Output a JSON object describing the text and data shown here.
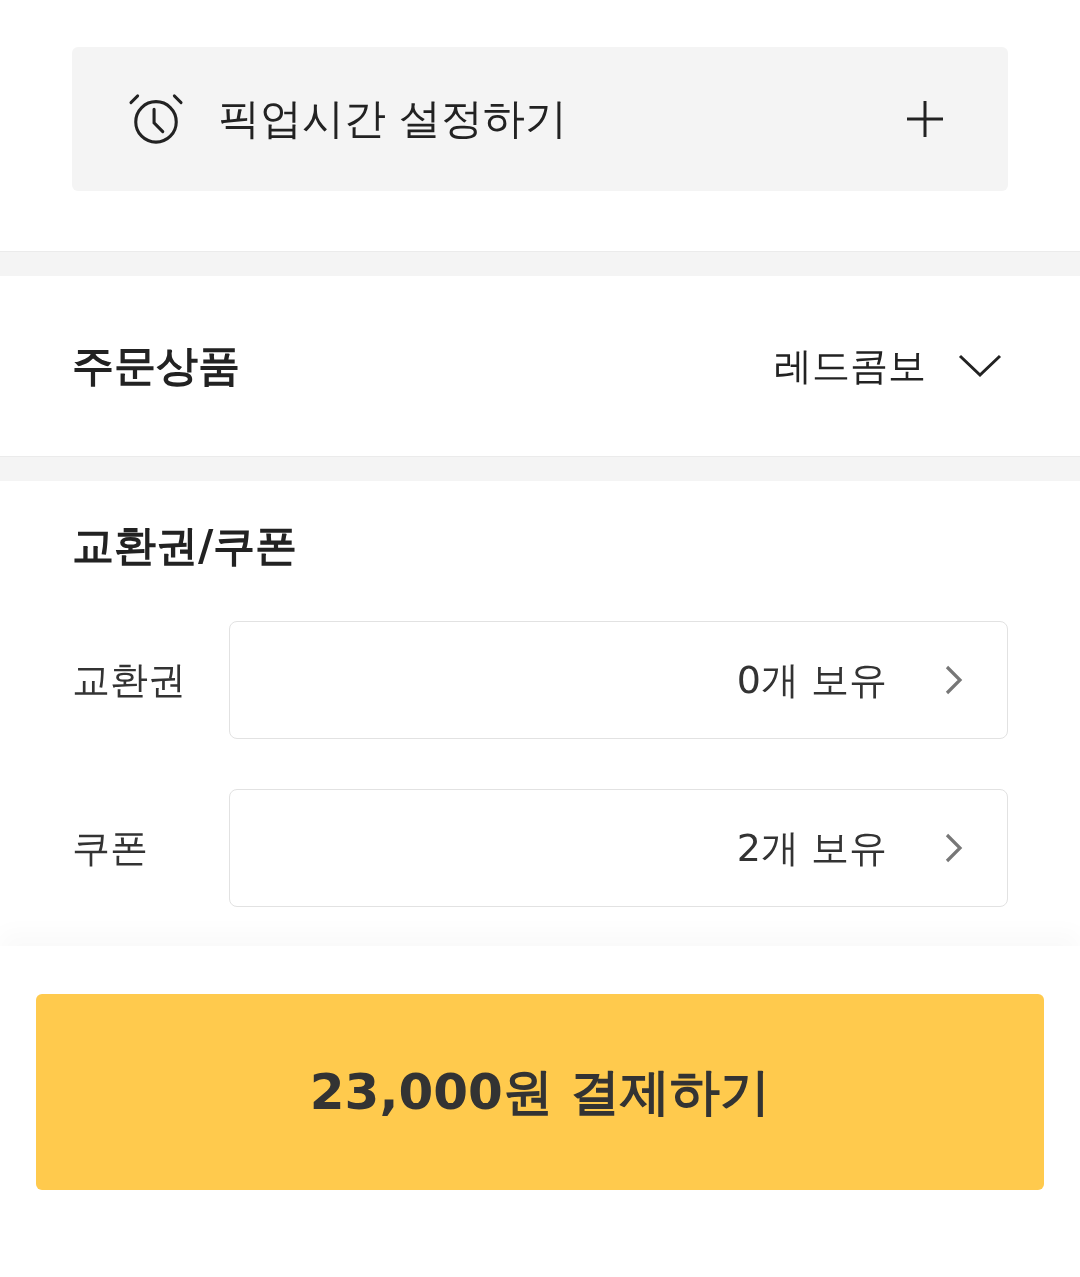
{
  "pickup_time": {
    "label": "픽업시간 설정하기"
  },
  "order_items": {
    "title": "주문상품",
    "summary": "레드콤보",
    "expanded": false
  },
  "vouchers": {
    "title": "교환권/쿠폰",
    "rows": [
      {
        "label": "교환권",
        "value": "0개 보유"
      },
      {
        "label": "쿠폰",
        "value": "2개 보유"
      }
    ]
  },
  "pay_button": {
    "label": "23,000원 결제하기"
  }
}
